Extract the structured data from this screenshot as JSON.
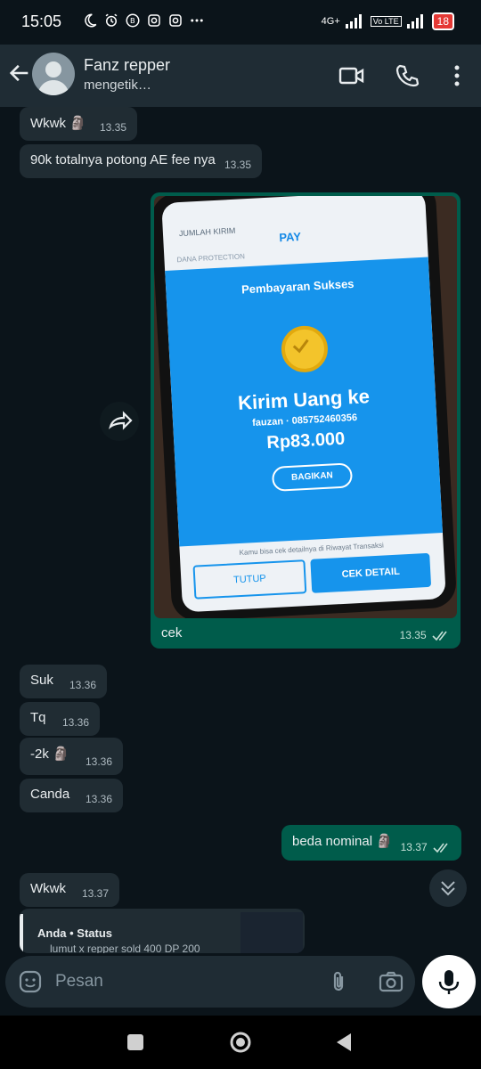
{
  "status_bar": {
    "time": "15:05",
    "network": "4G+",
    "volte": "Vo LTE",
    "battery": "18"
  },
  "header": {
    "contact_name": "Fanz repper",
    "status": "mengetik…"
  },
  "messages": [
    {
      "text": "Wkwk",
      "emoji": "🗿",
      "time": "13.35"
    },
    {
      "text": "90k totalnya potong AE fee nya",
      "time": "13.35"
    },
    {
      "caption": "cek",
      "time": "13.35"
    },
    {
      "text": "Suk",
      "time": "13.36"
    },
    {
      "text": "Tq",
      "time": "13.36"
    },
    {
      "text": "-2k",
      "emoji": "🗿",
      "time": "13.36"
    },
    {
      "text": "Canda",
      "time": "13.36"
    },
    {
      "text": "beda nominal",
      "emoji": "🗿",
      "time": "13.37"
    },
    {
      "text": "Wkwk",
      "time": "13.37"
    }
  ],
  "photo_content": {
    "top_label": "JUMLAH KIRIM",
    "pay_label": "PAY",
    "protection": "DANA PROTECTION",
    "title": "Pembayaran Sukses",
    "heading": "Kirim Uang ke",
    "recipient": "fauzan · 085752460356",
    "amount": "Rp83.000",
    "share_button": "BAGIKAN",
    "note": "Kamu bisa cek detailnya di Riwayat Transaksi",
    "close_button": "TUTUP",
    "detail_button": "CEK DETAIL"
  },
  "reply_preview": {
    "author": "Anda • Status",
    "snippet": "lumut x repper sold 400 DP 200"
  },
  "composer": {
    "placeholder": "Pesan"
  },
  "colors": {
    "incoming_bubble": "#202c33",
    "outgoing_bubble": "#005c4b",
    "background": "#0b141a",
    "header": "#1f2c34",
    "dana_blue": "#1694ec"
  }
}
